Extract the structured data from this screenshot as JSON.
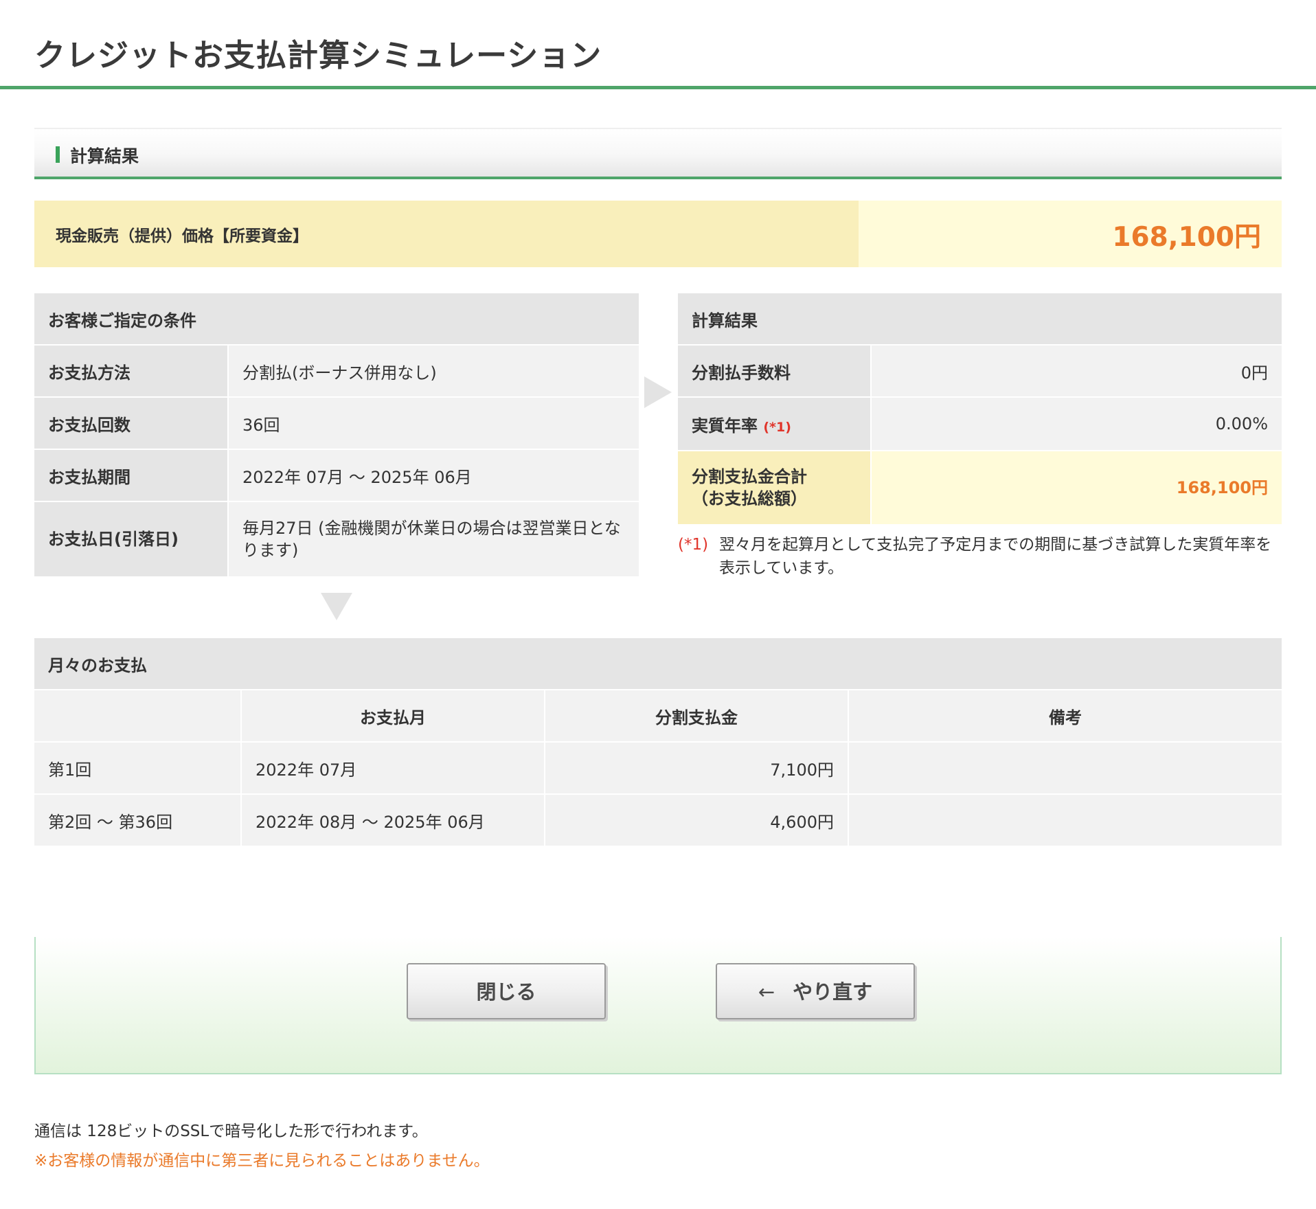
{
  "header": {
    "title": "クレジットお支払計算シミュレーション"
  },
  "section": {
    "title": "計算結果"
  },
  "price": {
    "label": "現金販売（提供）価格【所要資金】",
    "value": "168,100円"
  },
  "conditions": {
    "heading": "お客様ご指定の条件",
    "rows": [
      {
        "label": "お支払方法",
        "value": "分割払(ボーナス併用なし)"
      },
      {
        "label": "お支払回数",
        "value": "36回"
      },
      {
        "label": "お支払期間",
        "value": "2022年 07月 〜 2025年 06月"
      },
      {
        "label": "お支払日(引落日)",
        "value": "毎月27日 (金融機関が休業日の場合は翌営業日となります)"
      }
    ]
  },
  "results": {
    "heading": "計算結果",
    "rows": [
      {
        "label": "分割払手数料",
        "value": "0円"
      },
      {
        "label": "実質年率",
        "note": "(*1)",
        "value": "0.00%"
      },
      {
        "label_line1": "分割支払金合計",
        "label_line2": "（お支払総額）",
        "value": "168,100円"
      }
    ],
    "footnote_mark": "(*1)",
    "footnote_text": "翌々月を起算月として支払完了予定月までの期間に基づき試算した実質年率を表示しています。"
  },
  "monthly": {
    "heading": "月々のお支払",
    "columns": [
      "",
      "お支払月",
      "分割支払金",
      "備考"
    ],
    "rows": [
      {
        "no": "第1回",
        "month": "2022年 07月",
        "amount": "7,100円",
        "remarks": ""
      },
      {
        "no": "第2回 〜 第36回",
        "month": "2022年 08月 〜 2025年 06月",
        "amount": "4,600円",
        "remarks": ""
      }
    ]
  },
  "buttons": {
    "close": "閉じる",
    "retry_arrow": "←",
    "retry": "やり直す"
  },
  "footer": {
    "ssl_note": "通信は 128ビットのSSLで暗号化した形で行われます。",
    "warning": "※お客様の情報が通信中に第三者に見られることはありません。"
  },
  "colors": {
    "accent_green": "#4fa56a",
    "highlight_orange": "#ea7a2a",
    "note_red": "#e0352b"
  }
}
